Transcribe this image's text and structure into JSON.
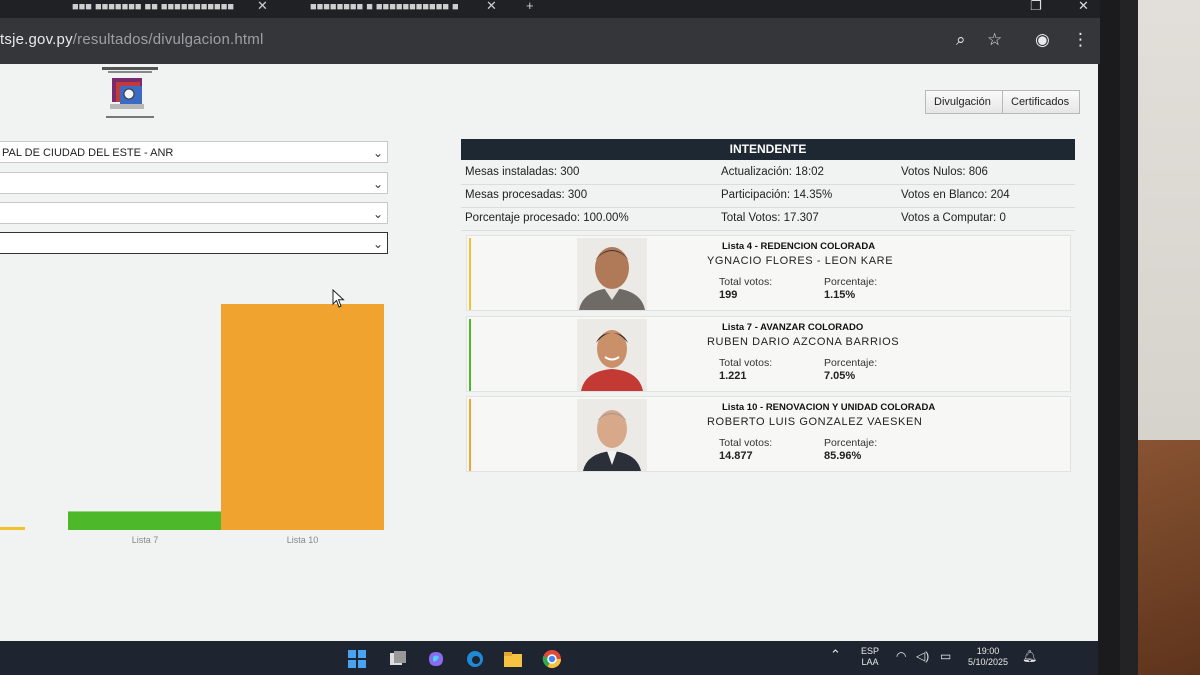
{
  "browser": {
    "tabs": [
      {
        "label": "■■■ ■■■■■■■ ■■ ■■■■■■■■■■■"
      },
      {
        "label": "■■■■■■■■ ■ ■■■■■■■■■■■ ■"
      }
    ],
    "url_domain": "tsje.gov.py",
    "url_path": "/resultados/divulgacion.html"
  },
  "page": {
    "nav": {
      "divulgacion": "Divulgación",
      "certificados": "Certificados"
    },
    "selects": [
      {
        "value": "PAL DE CIUDAD DEL ESTE - ANR"
      },
      {
        "value": ""
      },
      {
        "value": ""
      },
      {
        "value": ""
      }
    ],
    "results": {
      "title": "INTENDENTE",
      "stats": {
        "mesas_instaladas": "Mesas instaladas: 300",
        "actualizacion": "Actualización: 18:02",
        "votos_nulos": "Votos Nulos: 806",
        "mesas_procesadas": "Mesas procesadas: 300",
        "participacion": "Participación: 14.35%",
        "votos_blanco": "Votos en Blanco: 204",
        "porcentaje_procesado": "Porcentaje procesado: 100.00%",
        "total_votos": "Total Votos: 17.307",
        "votos_computar": "Votos a Computar: 0"
      },
      "candidates": [
        {
          "lista": "Lista 4 - REDENCION COLORADA",
          "name": "YGNACIO FLORES - LEON KARE",
          "total_label": "Total votos:",
          "total": "199",
          "pct_label": "Porcentaje:",
          "pct": "1.15%",
          "color": "#f2c12e"
        },
        {
          "lista": "Lista 7 - AVANZAR COLORADO",
          "name": "RUBEN DARIO AZCONA BARRIOS",
          "total_label": "Total votos:",
          "total": "1.221",
          "pct_label": "Porcentaje:",
          "pct": "7.05%",
          "color": "#4cb82a"
        },
        {
          "lista": "Lista 10 - RENOVACION Y UNIDAD COLORADA",
          "name": "ROBERTO LUIS GONZALEZ VAESKEN",
          "total_label": "Total votos:",
          "total": "14.877",
          "pct_label": "Porcentaje:",
          "pct": "85.96%",
          "color": "#f0a32e"
        }
      ]
    }
  },
  "chart_data": {
    "type": "bar",
    "categories": [
      "Lista 4",
      "Lista 7",
      "Lista 10"
    ],
    "values": [
      199,
      1221,
      14877
    ],
    "colors": [
      "#f2c12e",
      "#4cb82a",
      "#f0a32e"
    ],
    "visible_tick_labels": [
      "",
      "Lista 7",
      "Lista 10"
    ],
    "grid": false
  },
  "taskbar": {
    "lang": "ESP",
    "layout": "LAA",
    "time": "19:00",
    "date": "5/10/2025"
  }
}
